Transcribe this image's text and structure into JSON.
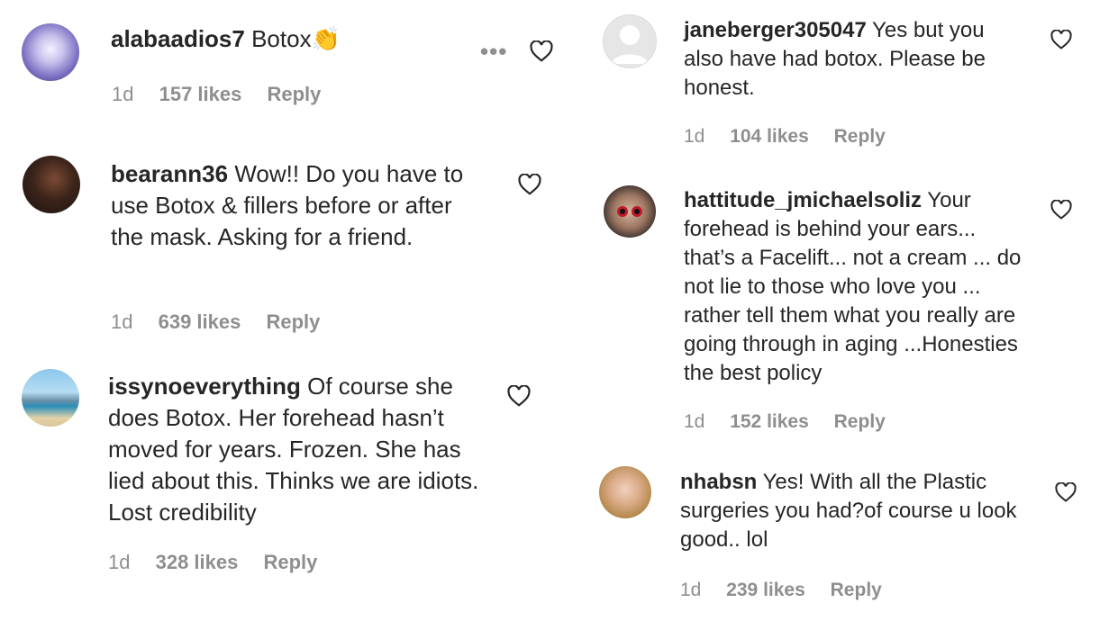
{
  "comments": [
    {
      "username": "alabaadios7",
      "text": "Botox👏",
      "time": "1d",
      "likes": "157 likes",
      "reply": "Reply"
    },
    {
      "username": "bearann36",
      "text": "Wow!! Do you have to use Botox & fillers before or after the mask. Asking for a friend.",
      "time": "1d",
      "likes": "639 likes",
      "reply": "Reply"
    },
    {
      "username": "issynoeverything",
      "text": "Of course she does Botox. Her forehead hasn’t moved for years. Frozen. She has lied about this. Thinks we are idiots. Lost credibility",
      "time": "1d",
      "likes": "328 likes",
      "reply": "Reply"
    },
    {
      "username": "janeberger305047",
      "text": "Yes but you also have had botox. Please be honest.",
      "time": "1d",
      "likes": "104 likes",
      "reply": "Reply"
    },
    {
      "username": "hattitude_jmichaelsoliz",
      "text": "Your forehead is behind your ears... that’s a Facelift... not a cream ... do not lie to those who love you ... rather tell them what you really are going through in aging ...Honesties the best policy",
      "time": "1d",
      "likes": "152 likes",
      "reply": "Reply"
    },
    {
      "username": "nhabsn",
      "text": "Yes! With all the Plastic surgeries you had?of course u look good.. lol",
      "time": "1d",
      "likes": "239 likes",
      "reply": "Reply"
    }
  ],
  "more_options": "•••"
}
